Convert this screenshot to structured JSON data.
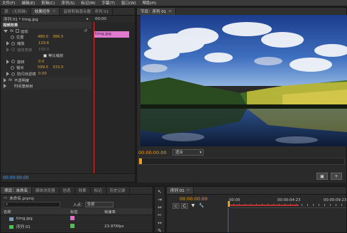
{
  "menu": [
    "文件(F)",
    "编辑(E)",
    "剪辑(C)",
    "序列(S)",
    "标记(M)",
    "字幕(T)",
    "窗口(W)",
    "帮助(H)"
  ],
  "source_panel": {
    "tabs": [
      "源：(无剪辑)",
      "效果控件",
      "音频剪辑混合器：序列 01"
    ],
    "sub_title": "序列 01 * timg.jpg",
    "clip_name": "timg.jpg",
    "timecode_ruler": "00:00",
    "section_video": "视频效果",
    "effect_motion": "运动",
    "position_label": "位置",
    "position_x": "480.0",
    "position_y": "366.5",
    "scale_label": "缩放",
    "scale_value": "129.6",
    "scale_width_label": "缩放宽度",
    "scale_width_value": "100.0",
    "uniform_scale": "等比缩放",
    "rotation_label": "旋转",
    "rotation_value": "0.0",
    "anchor_label": "锚点",
    "anchor_x": "599.5",
    "anchor_y": "333.0",
    "antiflicker_label": "防闪烁滤镜",
    "antiflicker_value": "0.00",
    "opacity_label": "不透明度",
    "time_remap_label": "时间重映射",
    "current_time": "00:00:00:00"
  },
  "program": {
    "tab": "节目：序列 01",
    "timecode": "00:00:00:00",
    "fit": "适合"
  },
  "project": {
    "tabs": [
      "项目：未命名",
      "媒体浏览器",
      "信息",
      "效果",
      "标记",
      "历史记录"
    ],
    "file": "未命名.prproj",
    "search_placeholder": "",
    "in_label": "入点：",
    "in_value": "全部",
    "col_name": "名称",
    "col_label": "标签",
    "col_framerate": "帧速率",
    "items": [
      {
        "name": "timg.jpg",
        "label_color": "#e070c8",
        "framerate": ""
      },
      {
        "name": "序列 01",
        "label_color": "#4fbf55",
        "framerate": "23.976fps"
      }
    ]
  },
  "timeline": {
    "tab": "序列 01",
    "timecode": "00:00:00:00",
    "ruler_start": "00:00",
    "ruler_mid": "00:00:04:23",
    "ruler_end": "00:00:09:23"
  },
  "colors": {
    "accent": "#e0a33c",
    "playhead": "#e03030",
    "timecode": "#e8a020",
    "clip": "#e07ad0"
  }
}
